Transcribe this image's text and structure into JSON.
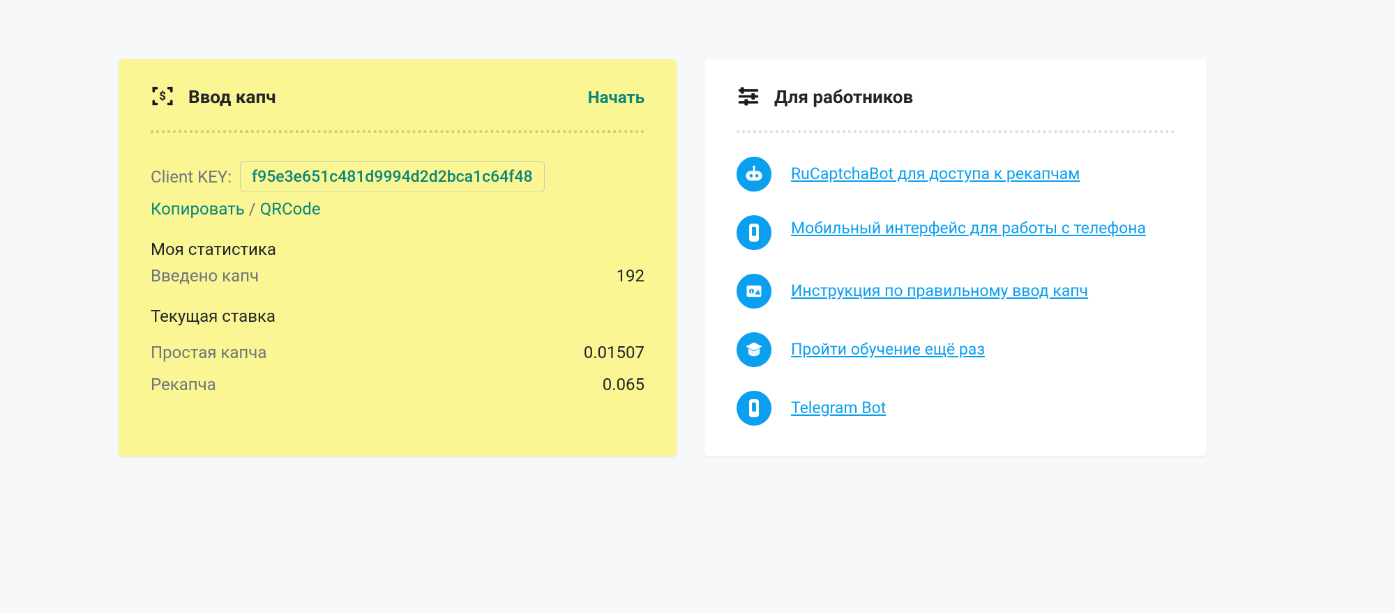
{
  "captcha_card": {
    "title": "Ввод капч",
    "start": "Начать",
    "client_key_label": "Client KEY:",
    "client_key_value": "f95e3e651c481d9994d2d2bca1c64f48",
    "copy": "Копировать",
    "sep": " / ",
    "qrcode": "QRCode",
    "stats_heading": "Моя статистика",
    "entered_label": "Введено капч",
    "entered_value": "192",
    "rate_heading": "Текущая ставка",
    "simple_label": "Простая капча",
    "simple_value": "0.01507",
    "recaptcha_label": "Рекапча",
    "recaptcha_value": "0.065"
  },
  "workers_card": {
    "title": "Для работников",
    "links": {
      "0": "RuCaptchaBot для доступа к рекапчам",
      "1": "Мобильный интерфейс для работы с телефона",
      "2": "Инструкция по правильному ввод капч",
      "3": "Пройти обучение ещё раз",
      "4": "Telegram Bot"
    }
  }
}
